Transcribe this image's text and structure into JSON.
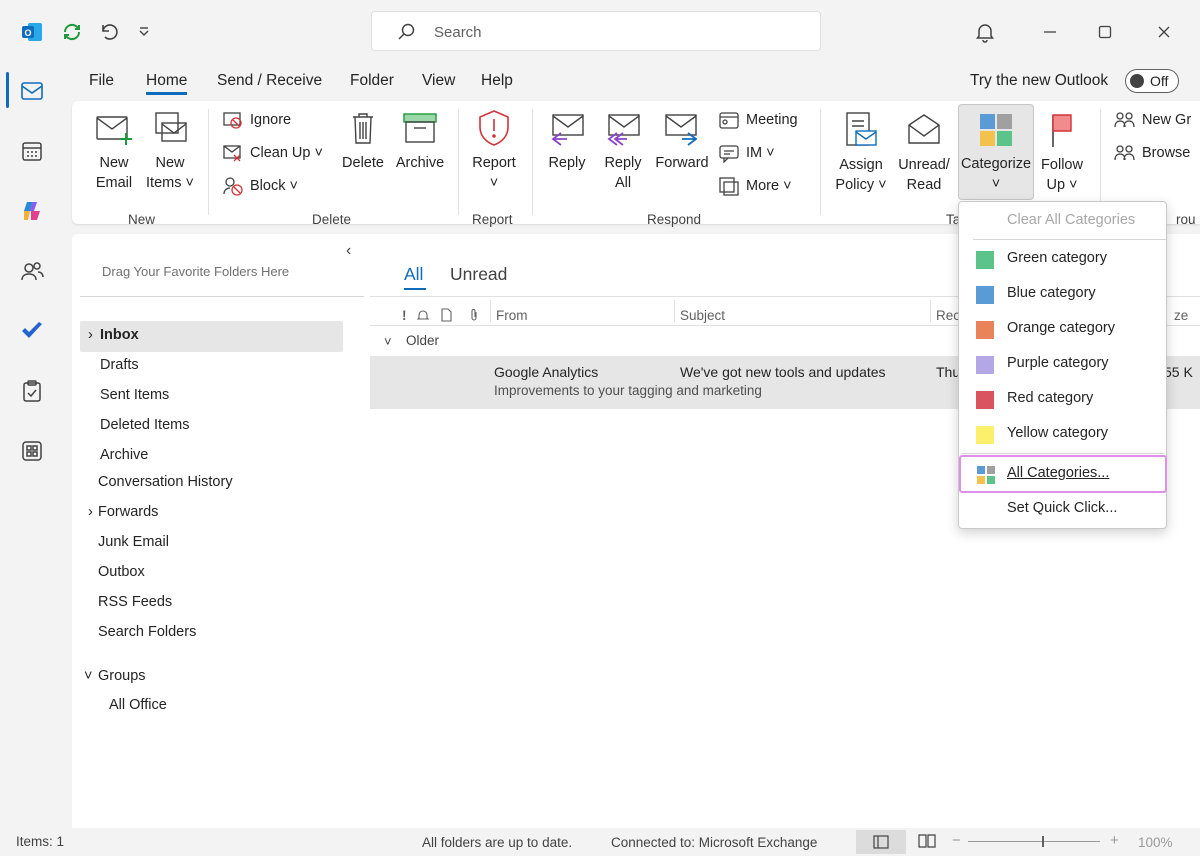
{
  "titlebar": {
    "search_placeholder": "Search",
    "icons": [
      "outlook-logo-icon",
      "sync-icon",
      "undo-icon",
      "customize-icon",
      "bell-icon",
      "minimize-icon",
      "maximize-icon",
      "close-icon"
    ]
  },
  "menu": {
    "tabs": [
      "File",
      "Home",
      "Send / Receive",
      "Folder",
      "View",
      "Help"
    ],
    "try_new_label": "Try the new Outlook",
    "toggle_label": "Off"
  },
  "ribbon": {
    "new": {
      "new_email_1": "New",
      "new_email_2": "Email",
      "new_items_1": "New",
      "new_items_2": "Items",
      "group": "New"
    },
    "delete": {
      "ignore": "Ignore",
      "clean_up": "Clean Up",
      "block": "Block",
      "delete": "Delete",
      "archive": "Archive",
      "group": "Delete"
    },
    "report": {
      "report": "Report",
      "group": "Report"
    },
    "respond": {
      "reply": "Reply",
      "reply_all_1": "Reply",
      "reply_all_2": "All",
      "forward": "Forward",
      "meeting": "Meeting",
      "im": "IM",
      "more": "More",
      "group": "Respond"
    },
    "tags": {
      "assign_1": "Assign",
      "assign_2": "Policy",
      "unread_1": "Unread/",
      "unread_2": "Read",
      "categorize": "Categorize",
      "follow_1": "Follow",
      "follow_2": "Up",
      "group_partial": "Ta"
    },
    "groups_more": {
      "new_group": "New Gr",
      "browse": "Browse",
      "group_partial": "rou"
    }
  },
  "folders": {
    "drag_hint": "Drag Your Favorite Folders Here",
    "items": [
      "Inbox",
      "Drafts",
      "Sent Items",
      "Deleted Items",
      "Archive",
      "Conversation History",
      "Forwards",
      "Junk Email",
      "Outbox",
      "RSS Feeds",
      "Search Folders"
    ],
    "groups_label": "Groups",
    "groups_items": [
      "All Office"
    ]
  },
  "mail": {
    "tabs": [
      "All",
      "Unread"
    ],
    "columns": {
      "from": "From",
      "subject": "Subject",
      "received": "Rec",
      "size": "ze"
    },
    "section": "Older",
    "message": {
      "from": "Google Analytics",
      "subject": "We've got new tools and updates",
      "preview": "Improvements to your tagging and marketing",
      "received": "Thu",
      "size": "55 K"
    }
  },
  "category_menu": {
    "clear": "Clear All Categories",
    "items": [
      {
        "label": "Green category",
        "color": "#5cc48a"
      },
      {
        "label": "Blue category",
        "color": "#5b9bd5"
      },
      {
        "label": "Orange category",
        "color": "#e8835a"
      },
      {
        "label": "Purple category",
        "color": "#b4a7e5"
      },
      {
        "label": "Red category",
        "color": "#d9545d"
      },
      {
        "label": "Yellow category",
        "color": "#fbef6c"
      }
    ],
    "all": "All Categories...",
    "quick": "Set Quick Click...",
    "highlight_color": "#e08fe8"
  },
  "status": {
    "items": "Items: 1",
    "sync": "All folders are up to date.",
    "connected": "Connected to: Microsoft Exchange",
    "zoom": "100%"
  },
  "colors": {
    "accent": "#0f6cbd",
    "selected_row": "#e6e6e6"
  }
}
